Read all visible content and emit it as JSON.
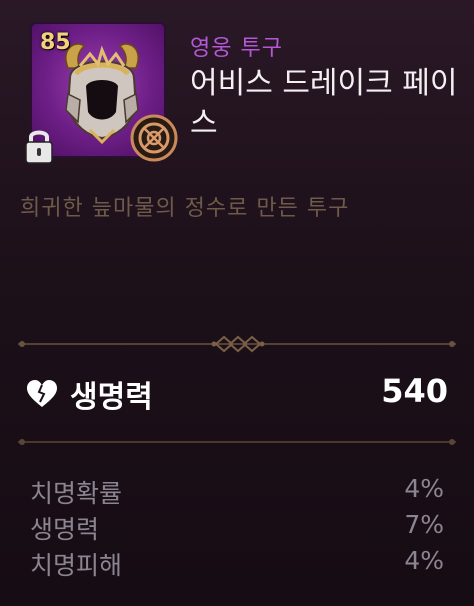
{
  "item": {
    "level": "85",
    "rarity": "영웅 투구",
    "name": "어비스 드레이크 페이스",
    "description": "희귀한 늪마물의 정수로 만든 투구",
    "locked": true
  },
  "main_stat": {
    "icon": "heart-icon",
    "label": "생명력",
    "value": "540"
  },
  "sub_stats": [
    {
      "label": "치명확률",
      "value": "4%"
    },
    {
      "label": "생명력",
      "value": "7%"
    },
    {
      "label": "치명피해",
      "value": "4%"
    }
  ],
  "colors": {
    "rarity": "#b458d6",
    "divider": "#5a4636",
    "level": "#f2d27a"
  }
}
